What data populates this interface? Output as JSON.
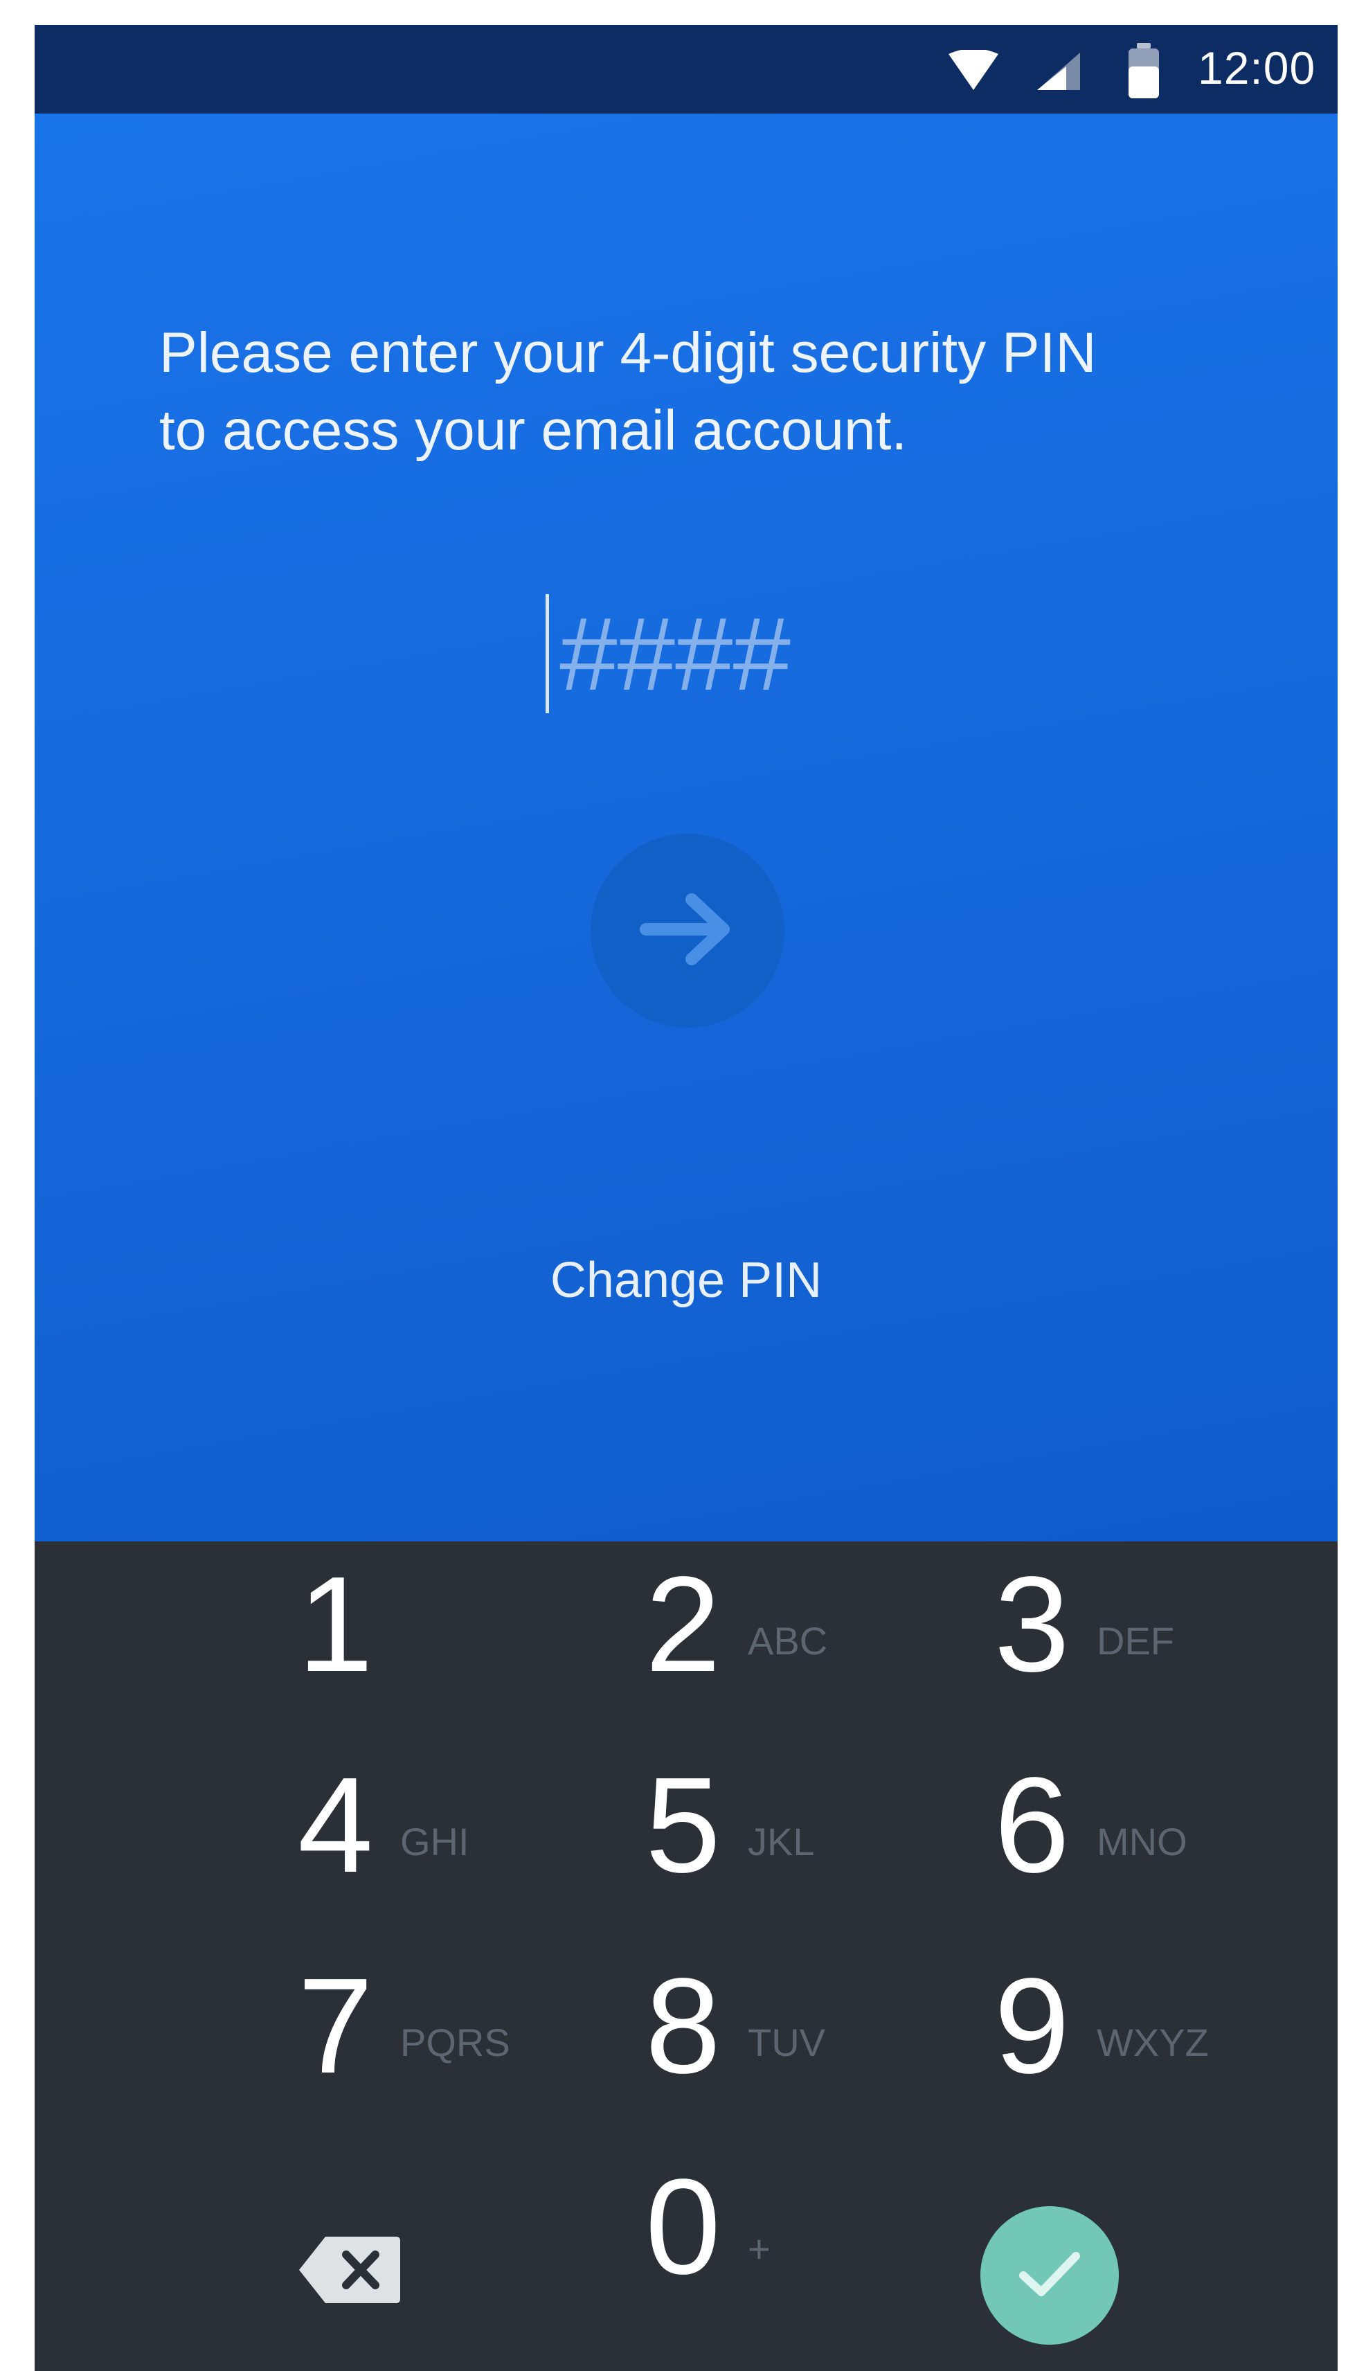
{
  "status_bar": {
    "time": "12:00",
    "icons": [
      "wifi-icon",
      "cell-signal-icon",
      "battery-icon"
    ]
  },
  "pin_screen": {
    "prompt_line1": "Please enter your 4-digit security PIN",
    "prompt_line2": "to access your email account.",
    "pin_placeholder": "####",
    "pin_value": "",
    "submit_icon": "arrow-right-icon",
    "change_pin_label": "Change PIN"
  },
  "keypad": {
    "keys": [
      {
        "digit": "1",
        "letters": ""
      },
      {
        "digit": "2",
        "letters": "ABC"
      },
      {
        "digit": "3",
        "letters": "DEF"
      },
      {
        "digit": "4",
        "letters": "GHI"
      },
      {
        "digit": "5",
        "letters": "JKL"
      },
      {
        "digit": "6",
        "letters": "MNO"
      },
      {
        "digit": "7",
        "letters": "PQRS"
      },
      {
        "digit": "8",
        "letters": "TUV"
      },
      {
        "digit": "9",
        "letters": "WXYZ"
      },
      {
        "digit": "0",
        "letters": "+"
      }
    ],
    "backspace_icon": "backspace-icon",
    "confirm_icon": "check-icon"
  },
  "colors": {
    "status_bar": "#0d2c63",
    "primary_blue": "#1973e8",
    "keypad_background": "#2a3036",
    "confirm_accent": "#72c7b6"
  }
}
